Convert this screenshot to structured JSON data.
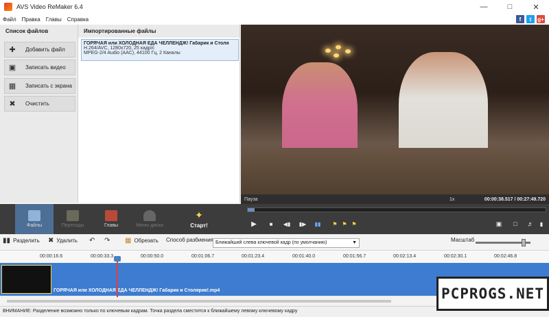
{
  "window": {
    "title": "AVS Video ReMaker 6.4"
  },
  "menu": [
    "Файл",
    "Правка",
    "Главы",
    "Справка"
  ],
  "social": [
    "f",
    "t",
    "g+"
  ],
  "sidebar": {
    "title": "Список файлов",
    "buttons": [
      {
        "label": "Добавить файл",
        "icon": "plus-icon"
      },
      {
        "label": "Записать видео",
        "icon": "camera-icon"
      },
      {
        "label": "Записать с экрана",
        "icon": "screen-icon"
      },
      {
        "label": "Очистить",
        "icon": "clear-icon"
      }
    ]
  },
  "files": {
    "title": "Импортированные файлы",
    "entry": {
      "name": "ГОРЯЧАЯ или ХОЛОДНАЯ ЕДА ЧЕЛЛЕНДЖ! Габарик и Столя",
      "video": "H.264/AVC, 1280x720, 25 кадр/с",
      "audio": "MPEG-2/4 Audio (AAC), 44100 Гц, 2 Каналы"
    }
  },
  "player": {
    "state": "Пауза",
    "speed": "1x",
    "time": "00:00:38.517 / 00:27:49.720",
    "progress": 0.023
  },
  "toolbar": {
    "tabs": [
      {
        "label": "Файлы",
        "active": true
      },
      {
        "label": "Переходы",
        "disabled": true
      },
      {
        "label": "Главы"
      },
      {
        "label": "Меню диска",
        "disabled": true
      }
    ],
    "start": "Старт!"
  },
  "edit": {
    "split": "Разделить",
    "delete": "Удалить",
    "trim": "Обрезать",
    "split_mode_label": "Способ разбиения:",
    "split_mode_value": "Ближайший слева ключевой кадр (по умолчанию)",
    "zoom_label": "Масштаб"
  },
  "ruler": [
    "00:00:16.6",
    "00:00:33.3",
    "00:00:50.0",
    "00:01:06.7",
    "00:01:23.4",
    "00:01:40.0",
    "00:01:56.7",
    "00:02:13.4",
    "00:02:30.1",
    "00:02:46.8"
  ],
  "timeline": {
    "clip_label": "ГОРЯЧАЯ или ХОЛОДНАЯ ЕДА ЧЕЛЛЕНДЖ! Габарик и Столярик!.mp4"
  },
  "status": "ВНИМАНИЕ: Разделение возможно только по ключевым кадрам. Точка раздела сместится к ближайшему левому ключевому кадру",
  "watermark": "PCPROGS.NET",
  "colors": {
    "accent": "#4d6e95",
    "track": "#3d7cd0",
    "dark": "#3c3c3c"
  }
}
